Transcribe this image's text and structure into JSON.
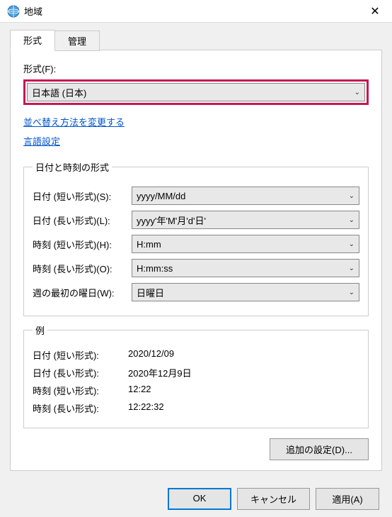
{
  "title": "地域",
  "tabs": {
    "format": "形式",
    "admin": "管理"
  },
  "format_label": "形式(F):",
  "format_value": "日本語 (日本)",
  "links": {
    "sort": "並べ替え方法を変更する",
    "lang": "言語設定"
  },
  "datetime_group": "日付と時刻の形式",
  "rows": {
    "short_date": {
      "label": "日付 (短い形式)(S):",
      "value": "yyyy/MM/dd"
    },
    "long_date": {
      "label": "日付 (長い形式)(L):",
      "value": "yyyy'年'M'月'd'日'"
    },
    "short_time": {
      "label": "時刻 (短い形式)(H):",
      "value": "H:mm"
    },
    "long_time": {
      "label": "時刻 (長い形式)(O):",
      "value": "H:mm:ss"
    },
    "first_day": {
      "label": "週の最初の曜日(W):",
      "value": "日曜日"
    }
  },
  "example_group": "例",
  "examples": {
    "short_date": {
      "label": "日付 (短い形式):",
      "value": "2020/12/09"
    },
    "long_date": {
      "label": "日付 (長い形式):",
      "value": "2020年12月9日"
    },
    "short_time": {
      "label": "時刻 (短い形式):",
      "value": "12:22"
    },
    "long_time": {
      "label": "時刻 (長い形式):",
      "value": "12:22:32"
    }
  },
  "buttons": {
    "additional": "追加の設定(D)...",
    "ok": "OK",
    "cancel": "キャンセル",
    "apply": "適用(A)"
  }
}
